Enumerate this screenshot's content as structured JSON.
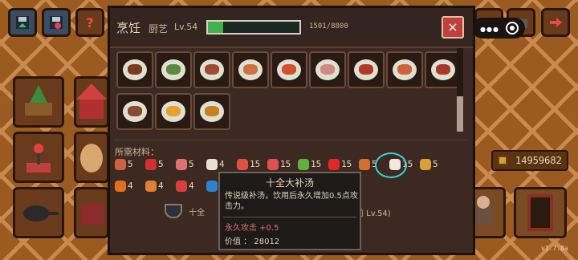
{
  "panel": {
    "title": "烹饪",
    "skill_label": "厨艺",
    "level": "Lv.54",
    "progress": 0.17,
    "progress_text": "1501/8800",
    "close_icon": "×"
  },
  "top_buttons": [
    {
      "name": "save-button",
      "icon": "save-up-icon",
      "color": "#3a4c60"
    },
    {
      "name": "save-load-button",
      "icon": "save-heart-icon",
      "color": "#3a4c60"
    },
    {
      "name": "help-button",
      "icon": "question-icon",
      "color": "#3a4c60"
    }
  ],
  "right_top_buttons": [
    {
      "name": "pet-button",
      "icon": "cat-icon"
    },
    {
      "name": "camera-button",
      "icon": "camera-icon"
    },
    {
      "name": "exit-button",
      "icon": "exit-arrow-icon"
    }
  ],
  "recipes": [
    {
      "name": "recipe-steak-plate",
      "color": "#7a3a20"
    },
    {
      "name": "recipe-vegetable-plate",
      "color": "#5a8a40"
    },
    {
      "name": "recipe-roast-meat",
      "color": "#a04a30"
    },
    {
      "name": "recipe-fish",
      "color": "#d07040"
    },
    {
      "name": "recipe-tomato-soup",
      "color": "#d05030"
    },
    {
      "name": "recipe-pink-soup",
      "color": "#d08a80"
    },
    {
      "name": "recipe-ribs",
      "color": "#b03a28"
    },
    {
      "name": "recipe-pizza",
      "color": "#d06040"
    },
    {
      "name": "recipe-red-stew",
      "color": "#a83828"
    },
    {
      "name": "recipe-sliced-meat",
      "color": "#8a4a30"
    },
    {
      "name": "recipe-omelette",
      "color": "#e8a030"
    },
    {
      "name": "recipe-dark-soup",
      "color": "#c88020"
    }
  ],
  "materials_title": "所需材料：",
  "materials": [
    {
      "name": "material-meat",
      "count": "5",
      "color": "#d06040"
    },
    {
      "name": "material-red-pepper",
      "count": "5",
      "color": "#d03030"
    },
    {
      "name": "material-sausage",
      "count": "5",
      "color": "#e07070"
    },
    {
      "name": "material-bone",
      "count": "4",
      "color": "#e8e0d0"
    },
    {
      "name": "material-salmon",
      "count": "15",
      "color": "#e05040"
    },
    {
      "name": "material-sausage-link",
      "count": "15",
      "color": "#e05050"
    },
    {
      "name": "material-herb",
      "count": "15",
      "color": "#60b040"
    },
    {
      "name": "material-tomato",
      "count": "15",
      "color": "#e02828"
    },
    {
      "name": "material-onion",
      "count": "5",
      "color": "#d07030"
    },
    {
      "name": "material-egg",
      "count": "15",
      "color": "#f0e8d8"
    },
    {
      "name": "material-wheat",
      "count": "5",
      "color": "#d8a030"
    },
    {
      "name": "material-carrot",
      "count": "4",
      "color": "#e07020"
    },
    {
      "name": "material-orange",
      "count": "4",
      "color": "#e08030"
    },
    {
      "name": "material-mushroom",
      "count": "4",
      "color": "#d84040"
    },
    {
      "name": "material-blue-gem",
      "count": "",
      "color": "#3080d0"
    }
  ],
  "craft": {
    "text_start": "十全",
    "text_end": "前 Lv.54)"
  },
  "tooltip": {
    "title": "十全大补汤",
    "description": "传说级补汤，饮用后永久增加0.5点攻击力。",
    "stat": "永久攻击 +0.5",
    "value": "价值 ： 28012"
  },
  "coins": "14959682",
  "version": "v1.7.8a"
}
